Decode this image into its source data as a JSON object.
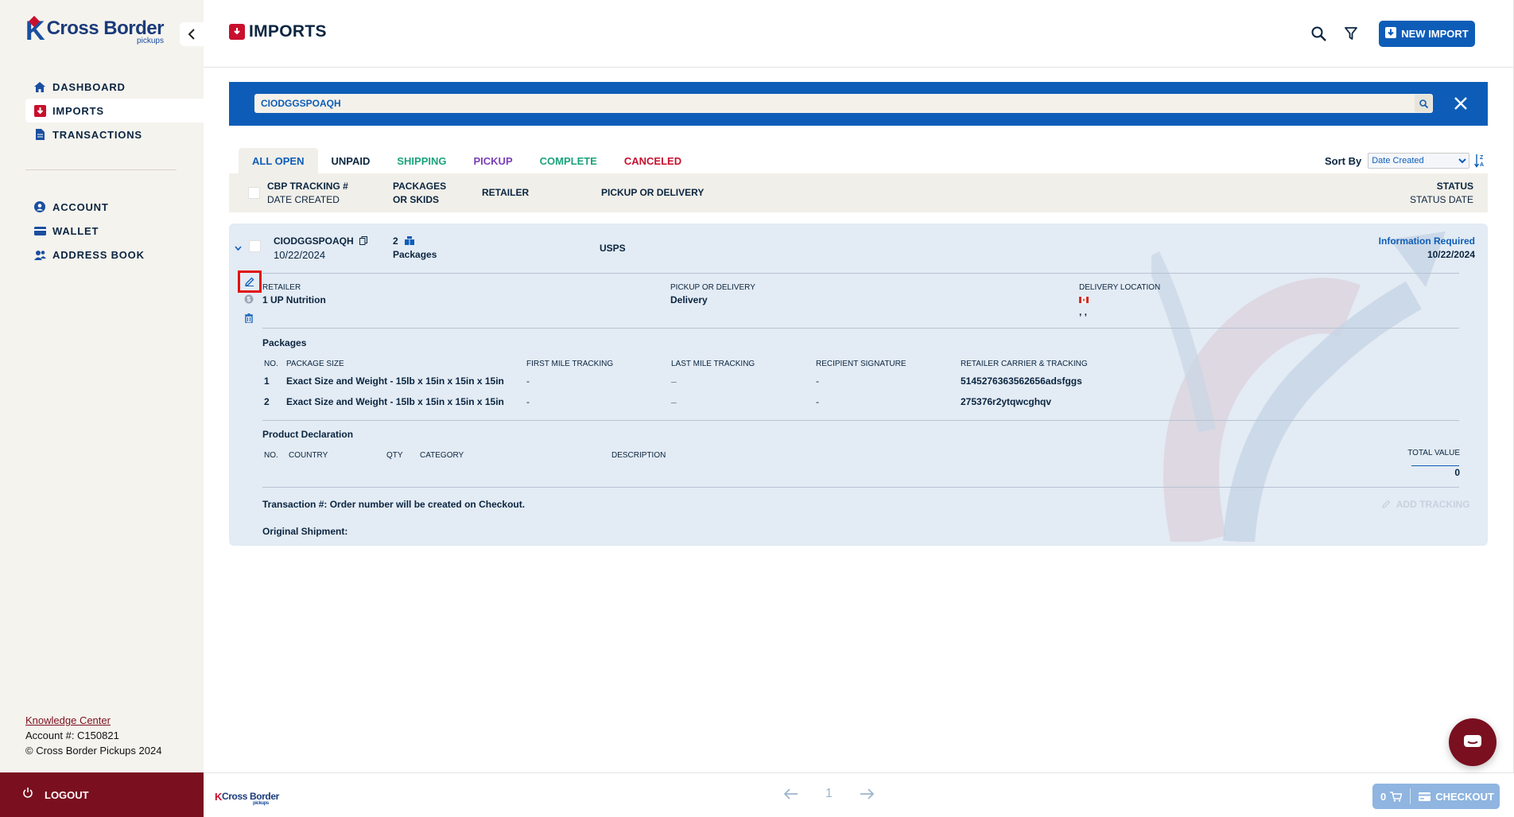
{
  "brand": {
    "name": "Cross Border",
    "sub": "pickups"
  },
  "sidebar": {
    "nav": [
      {
        "label": "DASHBOARD",
        "icon": "home-icon"
      },
      {
        "label": "IMPORTS",
        "icon": "imports-icon"
      },
      {
        "label": "TRANSACTIONS",
        "icon": "document-icon"
      }
    ],
    "nav2": [
      {
        "label": "ACCOUNT",
        "icon": "user-icon"
      },
      {
        "label": "WALLET",
        "icon": "wallet-icon"
      },
      {
        "label": "ADDRESS BOOK",
        "icon": "address-book-icon"
      }
    ],
    "knowledge": "Knowledge Center",
    "account": "Account #: C150821",
    "copyright": "© Cross Border Pickups 2024",
    "logout": "LOGOUT"
  },
  "header": {
    "title": "IMPORTS",
    "new_import": "NEW IMPORT"
  },
  "search": {
    "value": "CIODGGSPOAQH"
  },
  "tabs": [
    {
      "label": "ALL OPEN",
      "color": "#0d5db8"
    },
    {
      "label": "UNPAID",
      "color": "#0a2540"
    },
    {
      "label": "SHIPPING",
      "color": "#1aa37a"
    },
    {
      "label": "PICKUP",
      "color": "#7b3fb8"
    },
    {
      "label": "COMPLETE",
      "color": "#1aa37a"
    },
    {
      "label": "CANCELED",
      "color": "#c8102e"
    }
  ],
  "sort": {
    "label": "Sort By",
    "value": "Date Created"
  },
  "table_header": {
    "tracking": "CBP TRACKING #",
    "date_created": "DATE CREATED",
    "packages": "PACKAGES",
    "or_skids": "OR SKIDS",
    "retailer": "RETAILER",
    "pickup": "PICKUP OR DELIVERY",
    "status": "STATUS",
    "status_date": "STATUS DATE"
  },
  "record": {
    "tracking": "CIODGGSPOAQH",
    "date": "10/22/2024",
    "pkg_count": "2",
    "pkg_label": "Packages",
    "carrier": "USPS",
    "status": "Information Required",
    "status_date": "10/22/2024",
    "retailer_label": "RETAILER",
    "retailer": "1 UP Nutrition",
    "pickup_label": "PICKUP OR DELIVERY",
    "pickup": "Delivery",
    "location_label": "DELIVERY LOCATION",
    "location_value": ", ,",
    "packages_title": "Packages",
    "pkg_cols": [
      "NO.",
      "PACKAGE SIZE",
      "FIRST MILE TRACKING",
      "LAST MILE TRACKING",
      "RECIPIENT SIGNATURE",
      "RETAILER CARRIER & TRACKING"
    ],
    "pkg_rows": [
      {
        "no": "1",
        "size": "Exact Size and Weight - 15lb x 15in x 15in x 15in",
        "first": "-",
        "last": "_",
        "sig": "-",
        "carrier": "5145276363562656adsfggs"
      },
      {
        "no": "2",
        "size": "Exact Size and Weight - 15lb x 15in x 15in x 15in",
        "first": "-",
        "last": "_",
        "sig": "-",
        "carrier": "275376r2ytqwcghqv"
      }
    ],
    "decl_title": "Product Declaration",
    "decl_cols": [
      "NO.",
      "COUNTRY",
      "QTY",
      "CATEGORY",
      "DESCRIPTION",
      "TOTAL VALUE"
    ],
    "total_value": "0",
    "transaction": "Transaction #: Order number will be created on Checkout.",
    "original": "Original Shipment:",
    "add_tracking": "ADD TRACKING"
  },
  "footer": {
    "page": "1",
    "cart_count": "0",
    "checkout": "CHECKOUT"
  },
  "colors": {
    "primary": "#0d5db8",
    "brand_red": "#7a0f1f",
    "accent_red": "#c8102e",
    "card_bg": "#e3ebf4",
    "sidebar_bg": "#f5f3ee"
  }
}
